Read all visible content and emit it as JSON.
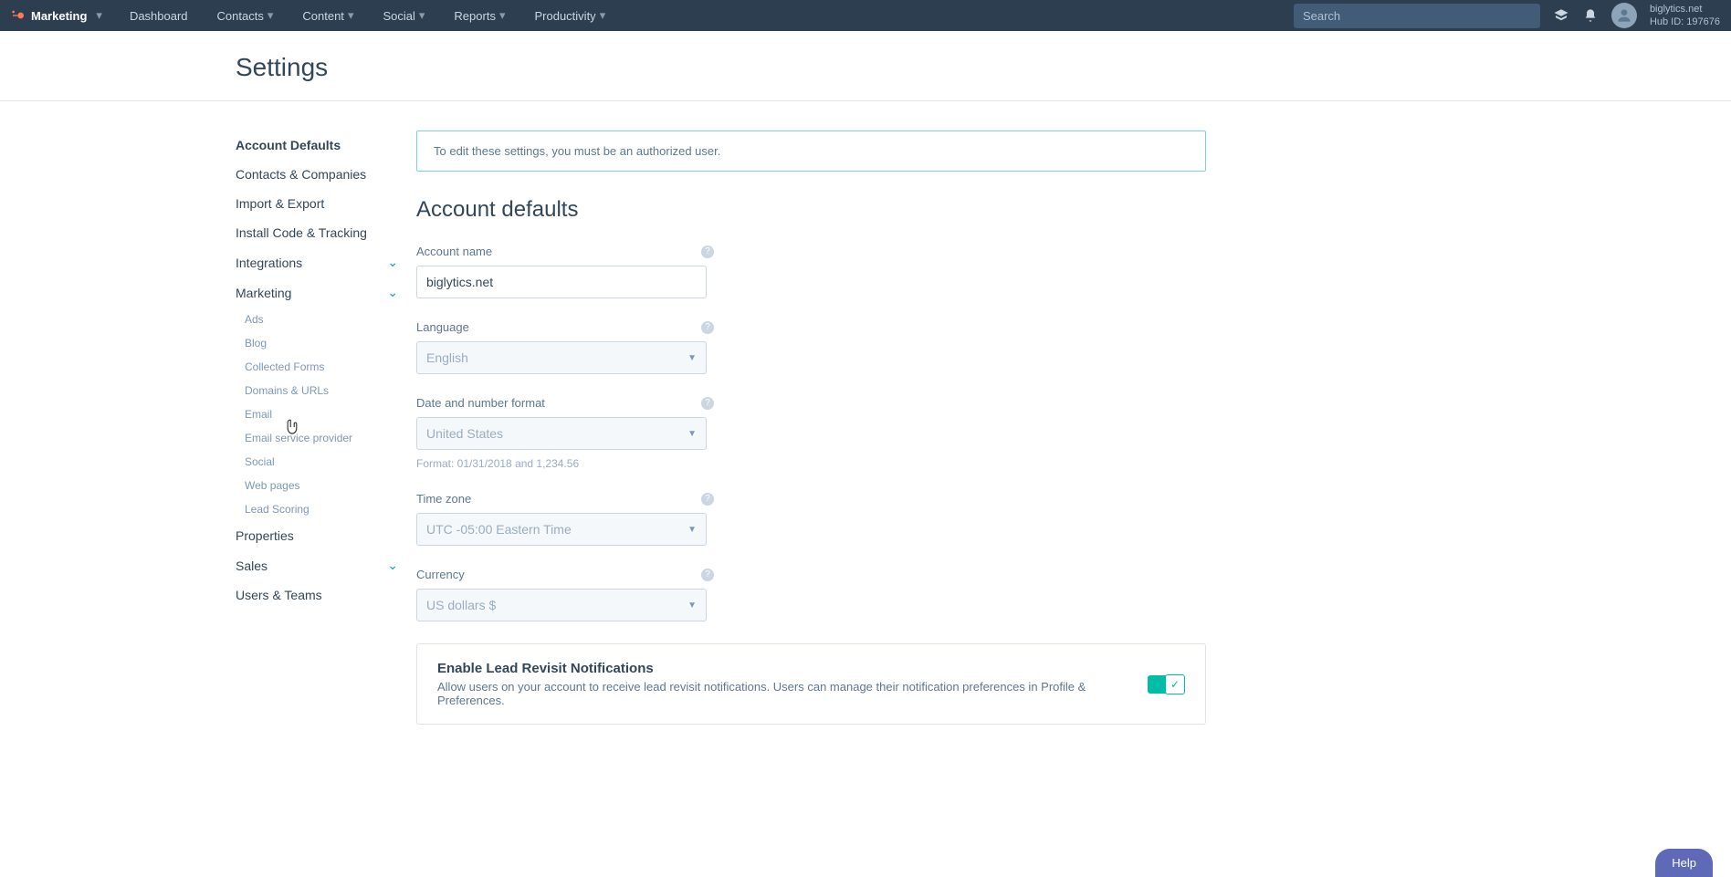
{
  "topnav": {
    "brand": "Marketing",
    "items": [
      "Dashboard",
      "Contacts",
      "Content",
      "Social",
      "Reports",
      "Productivity"
    ],
    "search_placeholder": "Search",
    "account_name": "biglytics.net",
    "hub_id_label": "Hub ID: 197676"
  },
  "page": {
    "title": "Settings"
  },
  "sidebar": {
    "items": [
      {
        "label": "Account Defaults",
        "active": true
      },
      {
        "label": "Contacts & Companies"
      },
      {
        "label": "Import & Export"
      },
      {
        "label": "Install Code & Tracking"
      },
      {
        "label": "Integrations",
        "expandable": true
      },
      {
        "label": "Marketing",
        "expandable": true,
        "expanded": true,
        "children": [
          "Ads",
          "Blog",
          "Collected Forms",
          "Domains & URLs",
          "Email",
          "Email service provider",
          "Social",
          "Web pages",
          "Lead Scoring"
        ]
      },
      {
        "label": "Properties"
      },
      {
        "label": "Sales",
        "expandable": true
      },
      {
        "label": "Users & Teams"
      }
    ]
  },
  "main": {
    "banner": "To edit these settings, you must be an authorized user.",
    "section_title": "Account defaults",
    "fields": {
      "account_name": {
        "label": "Account name",
        "value": "biglytics.net"
      },
      "language": {
        "label": "Language",
        "value": "English"
      },
      "date_format": {
        "label": "Date and number format",
        "value": "United States",
        "helper": "Format: 01/31/2018 and 1,234.56"
      },
      "timezone": {
        "label": "Time zone",
        "value": "UTC -05:00 Eastern Time"
      },
      "currency": {
        "label": "Currency",
        "value": "US dollars $"
      }
    },
    "card": {
      "title": "Enable Lead Revisit Notifications",
      "desc": "Allow users on your account to receive lead revisit notifications. Users can manage their notification preferences in Profile & Preferences."
    }
  },
  "help_label": "Help"
}
